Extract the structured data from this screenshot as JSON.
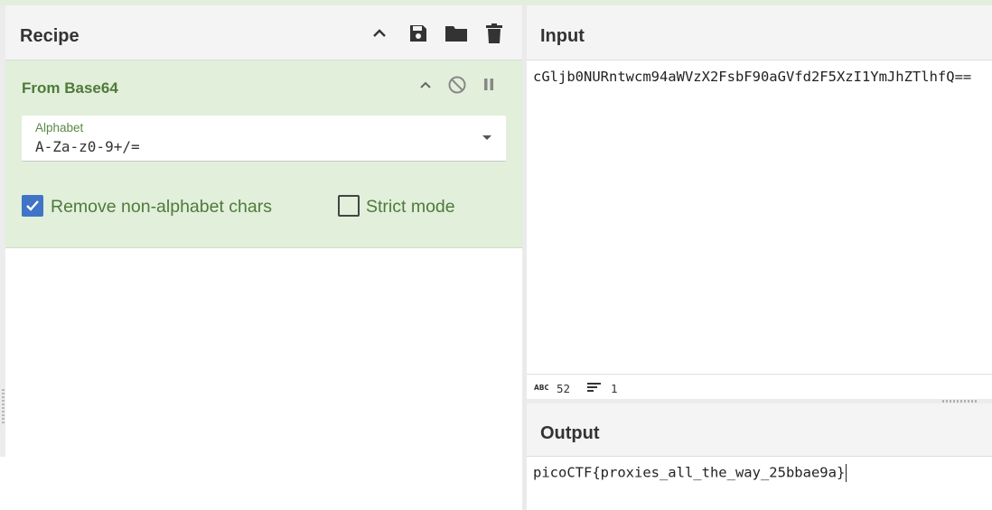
{
  "recipe": {
    "title": "Recipe",
    "icons": [
      "chevron-up-icon",
      "save-icon",
      "folder-icon",
      "trash-icon"
    ]
  },
  "operation": {
    "name": "From Base64",
    "icons": [
      "chevron-up-icon",
      "disable-icon",
      "pause-icon"
    ],
    "alphabet": {
      "label": "Alphabet",
      "value": "A-Za-z0-9+/="
    },
    "remove_non_alphabet": {
      "label": "Remove non-alphabet chars",
      "checked": true
    },
    "strict_mode": {
      "label": "Strict mode",
      "checked": false
    }
  },
  "input": {
    "title": "Input",
    "value": "cGljb0NURntwcm94aWVzX2FsbF90aGVfd2F5XzI1YmJhZTlhfQ==",
    "stats": {
      "length_icon_label": "ABC",
      "length": "52",
      "lines": "1"
    }
  },
  "output": {
    "title": "Output",
    "value": "picoCTF{proxies_all_the_way_25bbae9a}"
  },
  "colors": {
    "operation_bg": "#e1efdb",
    "operation_text": "#4f7a3a",
    "checkbox_accent": "#3f74c7"
  }
}
